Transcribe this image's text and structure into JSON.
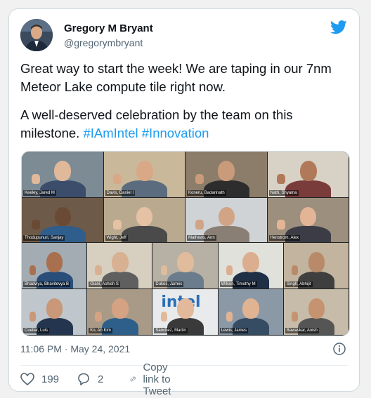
{
  "author": {
    "name": "Gregory M Bryant",
    "handle": "@gregorymbryant"
  },
  "tweet": {
    "line1": "Great way to start the week! We are taping in our 7nm Meteor Lake compute tile right now.",
    "line2_text": "A well-deserved celebration by the team on this milestone. ",
    "hashtag1": "#IAmIntel",
    "hashtag2": "#Innovation"
  },
  "media": {
    "participants": [
      "Keeley, Jared M",
      "Davis, Daniel I",
      "Koneru, Badarinath",
      "Nath, Shyama",
      "Thodupunuri, Sanjay",
      "Wight, Jeff",
      "Mathews, Ann",
      "Henstrom, Alex",
      "Bhadviya, Bhavitevya B",
      "Giani, Ashish S",
      "Dukes, James",
      "Wilson, Timothy M",
      "Singh, Abhijit",
      "Cuellar, Luis",
      "Ko, Ah Kim",
      "Sanchez, Martin",
      "Lewis, James",
      "Bawaskar, Anish"
    ],
    "intel_logo_text": "intel"
  },
  "timestamp": "11:06 PM · May 24, 2021",
  "actions": {
    "likes": "199",
    "replies": "2",
    "copy_link": "Copy link to Tweet"
  },
  "colors": {
    "accent": "#1d9bf0",
    "heart": "#536471"
  }
}
